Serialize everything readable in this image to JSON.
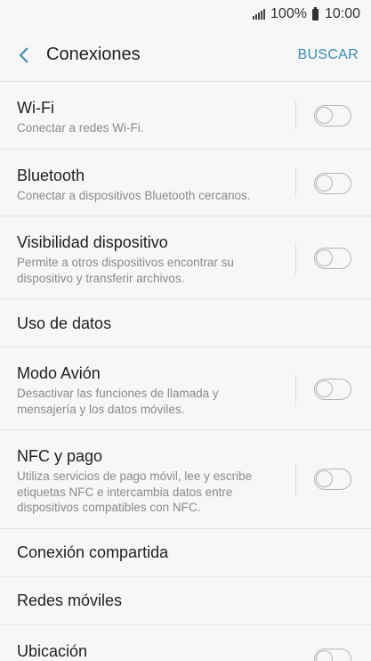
{
  "status": {
    "battery": "100%",
    "time": "10:00"
  },
  "header": {
    "title": "Conexiones",
    "search_label": "BUSCAR"
  },
  "items": [
    {
      "title": "Wi-Fi",
      "subtitle": "Conectar a redes Wi-Fi.",
      "toggle": "off"
    },
    {
      "title": "Bluetooth",
      "subtitle": "Conectar a dispositivos Bluetooth cercanos.",
      "toggle": "off"
    },
    {
      "title": "Visibilidad dispositivo",
      "subtitle": "Permite a otros dispositivos encontrar su dispositivo y transferir archivos.",
      "toggle": "off"
    },
    {
      "title": "Uso de datos"
    },
    {
      "title": "Modo Avión",
      "subtitle": "Desactivar las funciones de llamada y mensajería y los datos móviles.",
      "toggle": "off"
    },
    {
      "title": "NFC y pago",
      "subtitle": "Utiliza servicios de pago móvil, lee y escribe etiquetas NFC e intercambia datos entre dispositivos compatibles con NFC.",
      "toggle": "off"
    },
    {
      "title": "Conexión compartida"
    },
    {
      "title": "Redes móviles"
    },
    {
      "title": "Ubicación",
      "toggle": "off"
    }
  ]
}
